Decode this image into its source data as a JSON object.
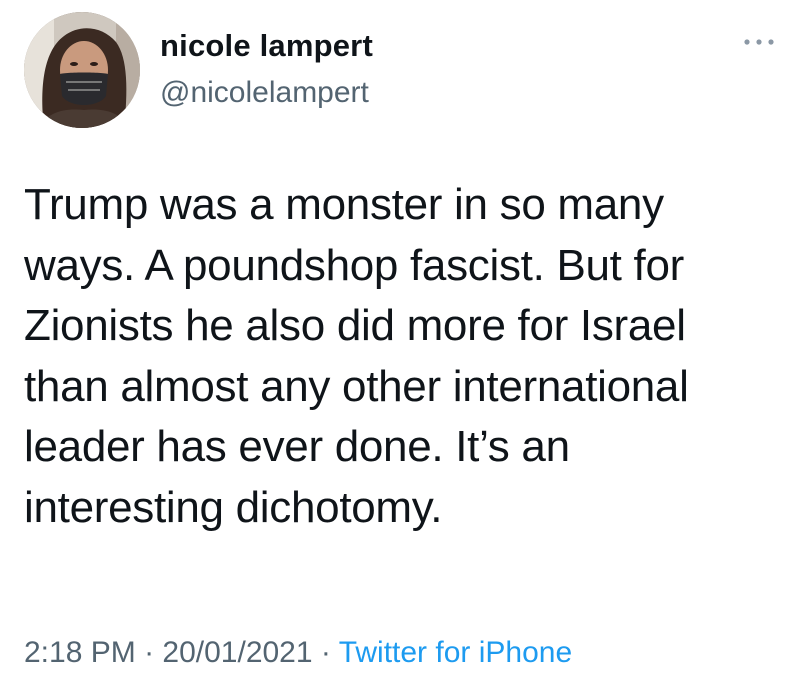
{
  "user": {
    "display_name": "nicole lampert",
    "handle": "@nicolelampert",
    "avatar_icon": "profile-photo"
  },
  "more_icon": "more-horizontal-icon",
  "tweet": {
    "lines": [
      "Trump was a monster in so many",
      "ways. A poundshop fascist. But for",
      "Zionists he also did more for Israel",
      "than almost any other international",
      "leader has ever done. It’s an",
      "interesting dichotomy."
    ]
  },
  "meta": {
    "time": "2:18 PM",
    "separator": " · ",
    "date": "20/01/2021",
    "separator2": " · ",
    "source": "Twitter for iPhone"
  },
  "colors": {
    "text": "#0f1419",
    "secondary": "#536471",
    "link": "#1d9bf0"
  }
}
